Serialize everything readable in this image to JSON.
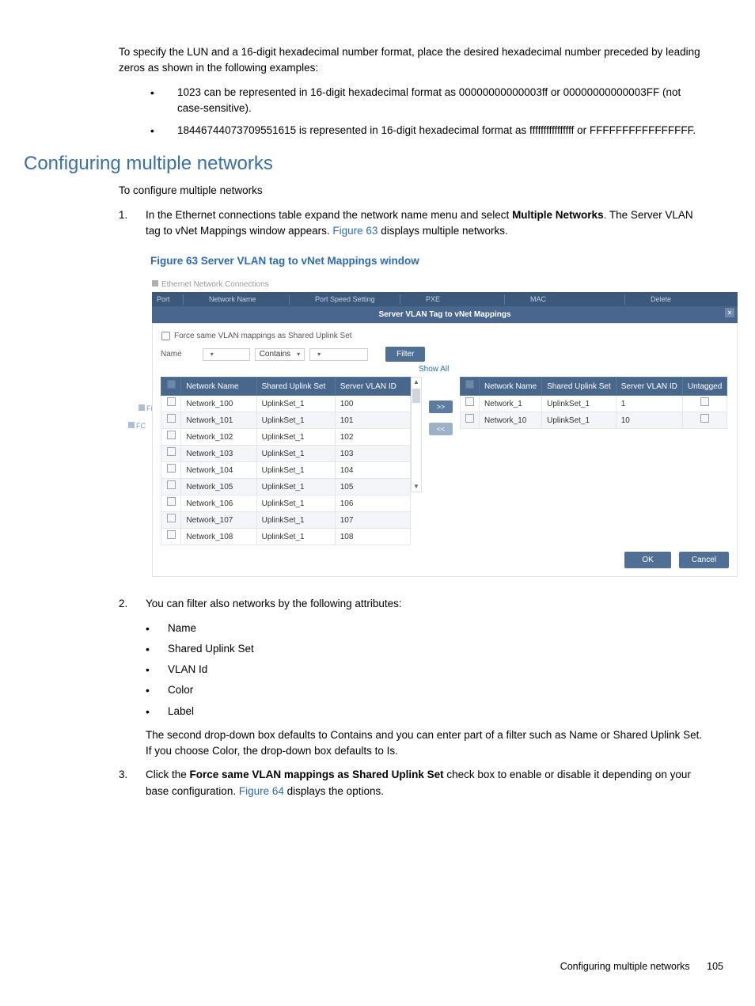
{
  "intro_para": "To specify the LUN and a 16-digit hexadecimal number format, place the desired hexadecimal number preceded by leading zeros as shown in the following examples:",
  "intro_bullets": [
    "1023 can be represented in 16-digit hexadecimal format as 00000000000003ff or 00000000000003FF (not case-sensitive).",
    "18446744073709551615 is represented in 16-digit hexadecimal format as ffffffffffffffff or FFFFFFFFFFFFFFFF."
  ],
  "section_heading": "Configuring multiple networks",
  "section_intro": "To configure multiple networks",
  "steps": {
    "s1_before": "In the Ethernet connections table expand the network name menu and select ",
    "s1_bold": "Multiple Networks",
    "s1_after": ". The Server VLAN tag to vNet Mappings window appears. ",
    "s1_link": "Figure 63",
    "s1_tail": " displays multiple networks.",
    "s2_lead": "You can filter also networks by the following attributes:",
    "s2_bullets": [
      "Name",
      "Shared Uplink Set",
      "VLAN Id",
      "Color",
      "Label"
    ],
    "s2_tail": "The second drop-down box defaults to Contains and you can enter part of a filter such as Name or Shared Uplink Set. If you choose Color, the drop-down box defaults to Is.",
    "s3_before": "Click the ",
    "s3_bold": "Force same VLAN mappings as Shared Uplink Set",
    "s3_mid": " check box to enable or disable it depending on your base configuration. ",
    "s3_link": "Figure 64",
    "s3_tail": " displays the options."
  },
  "figure_caption": "Figure 63 Server VLAN tag to vNet Mappings window",
  "app": {
    "title": "Ethernet Network Connections",
    "header_cols": {
      "port": "Port",
      "network_name": "Network Name",
      "port_speed": "Port Speed Setting",
      "pxe": "PXE",
      "mac": "MAC",
      "delete": "Delete"
    },
    "subheader": "Server VLAN Tag to vNet Mappings",
    "force_label": "Force same VLAN mappings as Shared Uplink Set",
    "filter": {
      "name_label": "Name",
      "contains": "Contains",
      "filter_btn": "Filter",
      "show_all": "Show All"
    },
    "left_cols": {
      "network_name": "Network Name",
      "shared_uplink": "Shared Uplink Set",
      "server_vlan": "Server VLAN ID"
    },
    "right_cols": {
      "network_name": "Network Name",
      "shared_uplink": "Shared Uplink Set",
      "server_vlan": "Server VLAN ID",
      "untagged": "Untagged"
    },
    "left_rows": [
      {
        "network": "Network_100",
        "uplink": "UplinkSet_1",
        "vlan": "100"
      },
      {
        "network": "Network_101",
        "uplink": "UplinkSet_1",
        "vlan": "101"
      },
      {
        "network": "Network_102",
        "uplink": "UplinkSet_1",
        "vlan": "102"
      },
      {
        "network": "Network_103",
        "uplink": "UplinkSet_1",
        "vlan": "103"
      },
      {
        "network": "Network_104",
        "uplink": "UplinkSet_1",
        "vlan": "104"
      },
      {
        "network": "Network_105",
        "uplink": "UplinkSet_1",
        "vlan": "105"
      },
      {
        "network": "Network_106",
        "uplink": "UplinkSet_1",
        "vlan": "106"
      },
      {
        "network": "Network_107",
        "uplink": "UplinkSet_1",
        "vlan": "107"
      },
      {
        "network": "Network_108",
        "uplink": "UplinkSet_1",
        "vlan": "108"
      }
    ],
    "right_rows": [
      {
        "network": "Network_1",
        "uplink": "UplinkSet_1",
        "vlan": "1"
      },
      {
        "network": "Network_10",
        "uplink": "UplinkSet_1",
        "vlan": "10"
      }
    ],
    "move_right": ">>",
    "move_left": "<<",
    "ok": "OK",
    "cancel": "Cancel",
    "side1": "Fi",
    "side2": "FC"
  },
  "footer": {
    "label": "Configuring multiple networks",
    "page": "105"
  }
}
